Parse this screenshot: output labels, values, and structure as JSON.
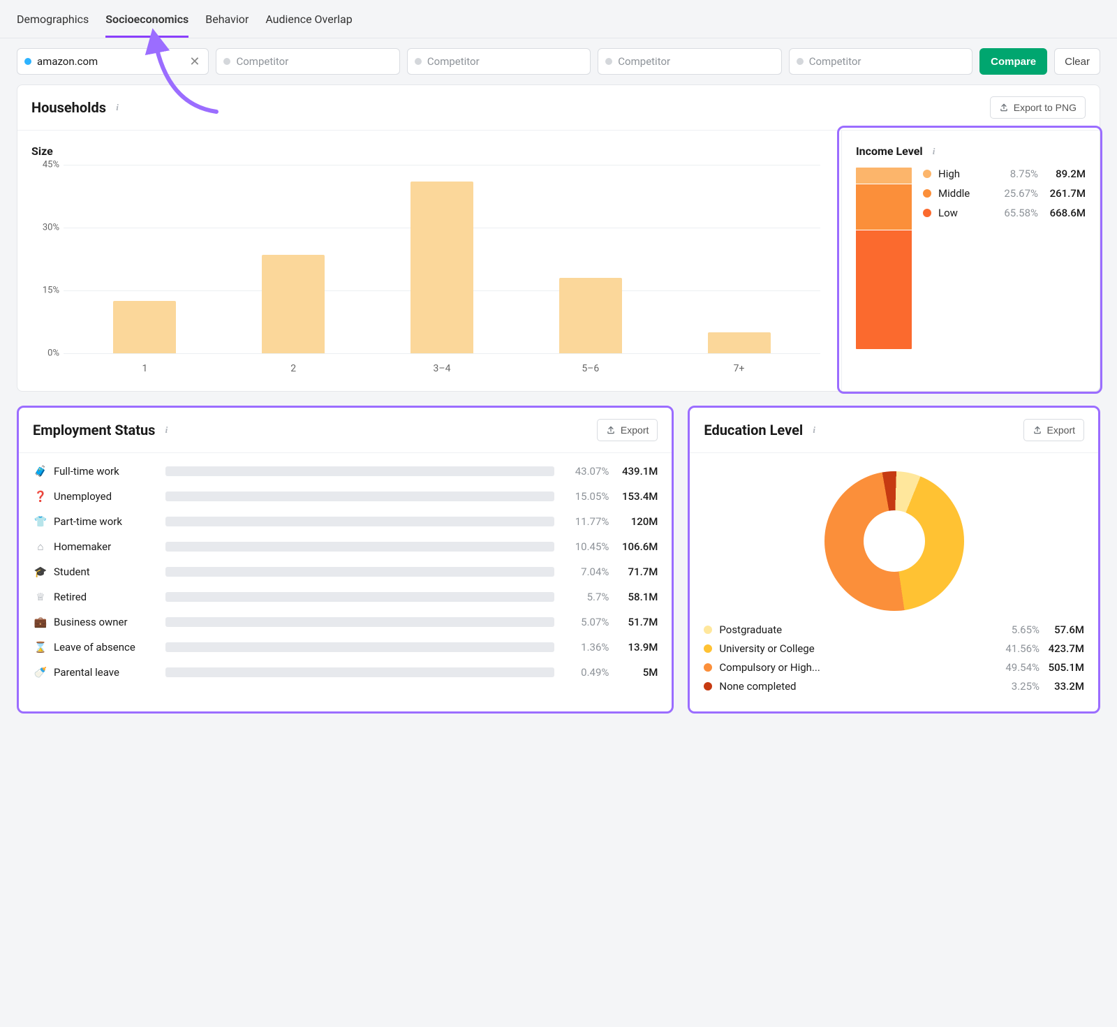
{
  "tabs": [
    "Demographics",
    "Socioeconomics",
    "Behavior",
    "Audience Overlap"
  ],
  "active_tab": "Socioeconomics",
  "domain_input": {
    "value": "amazon.com"
  },
  "competitor_placeholder": "Competitor",
  "buttons": {
    "compare": "Compare",
    "clear": "Clear",
    "export_png": "Export to PNG",
    "export": "Export"
  },
  "households": {
    "title": "Households",
    "size_title": "Size",
    "income_title": "Income Level"
  },
  "employment_title": "Employment Status",
  "education_title": "Education Level",
  "colors": {
    "bar": "#fbd79a",
    "emp_bar": "#ffc233",
    "income_high": "#fcb56b",
    "income_mid": "#fb8f3a",
    "income_low": "#fb6a2e",
    "edu_postgrad": "#ffe79c",
    "edu_univ": "#ffc233",
    "edu_comp": "#fb8f3a",
    "edu_none": "#c63a11",
    "highlight": "#9b6dff"
  },
  "chart_data": [
    {
      "id": "household_size",
      "type": "bar",
      "title": "Size",
      "ylabel": "percent",
      "ylim": [
        0,
        45
      ],
      "yticks": [
        0,
        15,
        30,
        45
      ],
      "categories": [
        "1",
        "2",
        "3–4",
        "5–6",
        "7+"
      ],
      "values": [
        12.5,
        23.5,
        41,
        18,
        5
      ]
    },
    {
      "id": "income_level",
      "type": "stacked_bar",
      "title": "Income Level",
      "series": [
        {
          "name": "High",
          "percent": 8.75,
          "value": "89.2M",
          "color": "#fcb56b"
        },
        {
          "name": "Middle",
          "percent": 25.67,
          "value": "261.7M",
          "color": "#fb8f3a"
        },
        {
          "name": "Low",
          "percent": 65.58,
          "value": "668.6M",
          "color": "#fb6a2e"
        }
      ]
    },
    {
      "id": "employment_status",
      "type": "hbar",
      "title": "Employment Status",
      "max_display": 43.07,
      "rows": [
        {
          "name": "Full-time work",
          "percent": 43.07,
          "value": "439.1M",
          "icon": "briefcase",
          "icon_color": "orange"
        },
        {
          "name": "Unemployed",
          "percent": 15.05,
          "value": "153.4M",
          "icon": "question",
          "icon_color": "orange"
        },
        {
          "name": "Part-time work",
          "percent": 11.77,
          "value": "120M",
          "icon": "tshirt",
          "icon_color": "orange"
        },
        {
          "name": "Homemaker",
          "percent": 10.45,
          "value": "106.6M",
          "icon": "home",
          "icon_color": "grey"
        },
        {
          "name": "Student",
          "percent": 7.04,
          "value": "71.7M",
          "icon": "grad",
          "icon_color": "grey"
        },
        {
          "name": "Retired",
          "percent": 5.7,
          "value": "58.1M",
          "icon": "crown",
          "icon_color": "grey"
        },
        {
          "name": "Business owner",
          "percent": 5.07,
          "value": "51.7M",
          "icon": "briefcase2",
          "icon_color": "grey"
        },
        {
          "name": "Leave of absence",
          "percent": 1.36,
          "value": "13.9M",
          "icon": "hourglass",
          "icon_color": "grey"
        },
        {
          "name": "Parental leave",
          "percent": 0.49,
          "value": "5M",
          "icon": "stroller",
          "icon_color": "grey"
        }
      ]
    },
    {
      "id": "education_level",
      "type": "pie",
      "title": "Education Level",
      "series": [
        {
          "name": "Postgraduate",
          "percent": 5.65,
          "value": "57.6M",
          "color": "#ffe79c"
        },
        {
          "name": "University or College",
          "percent": 41.56,
          "value": "423.7M",
          "color": "#ffc233"
        },
        {
          "name": "Compulsory or High...",
          "percent": 49.54,
          "value": "505.1M",
          "color": "#fb8f3a"
        },
        {
          "name": "None completed",
          "percent": 3.25,
          "value": "33.2M",
          "color": "#c63a11"
        }
      ]
    }
  ]
}
